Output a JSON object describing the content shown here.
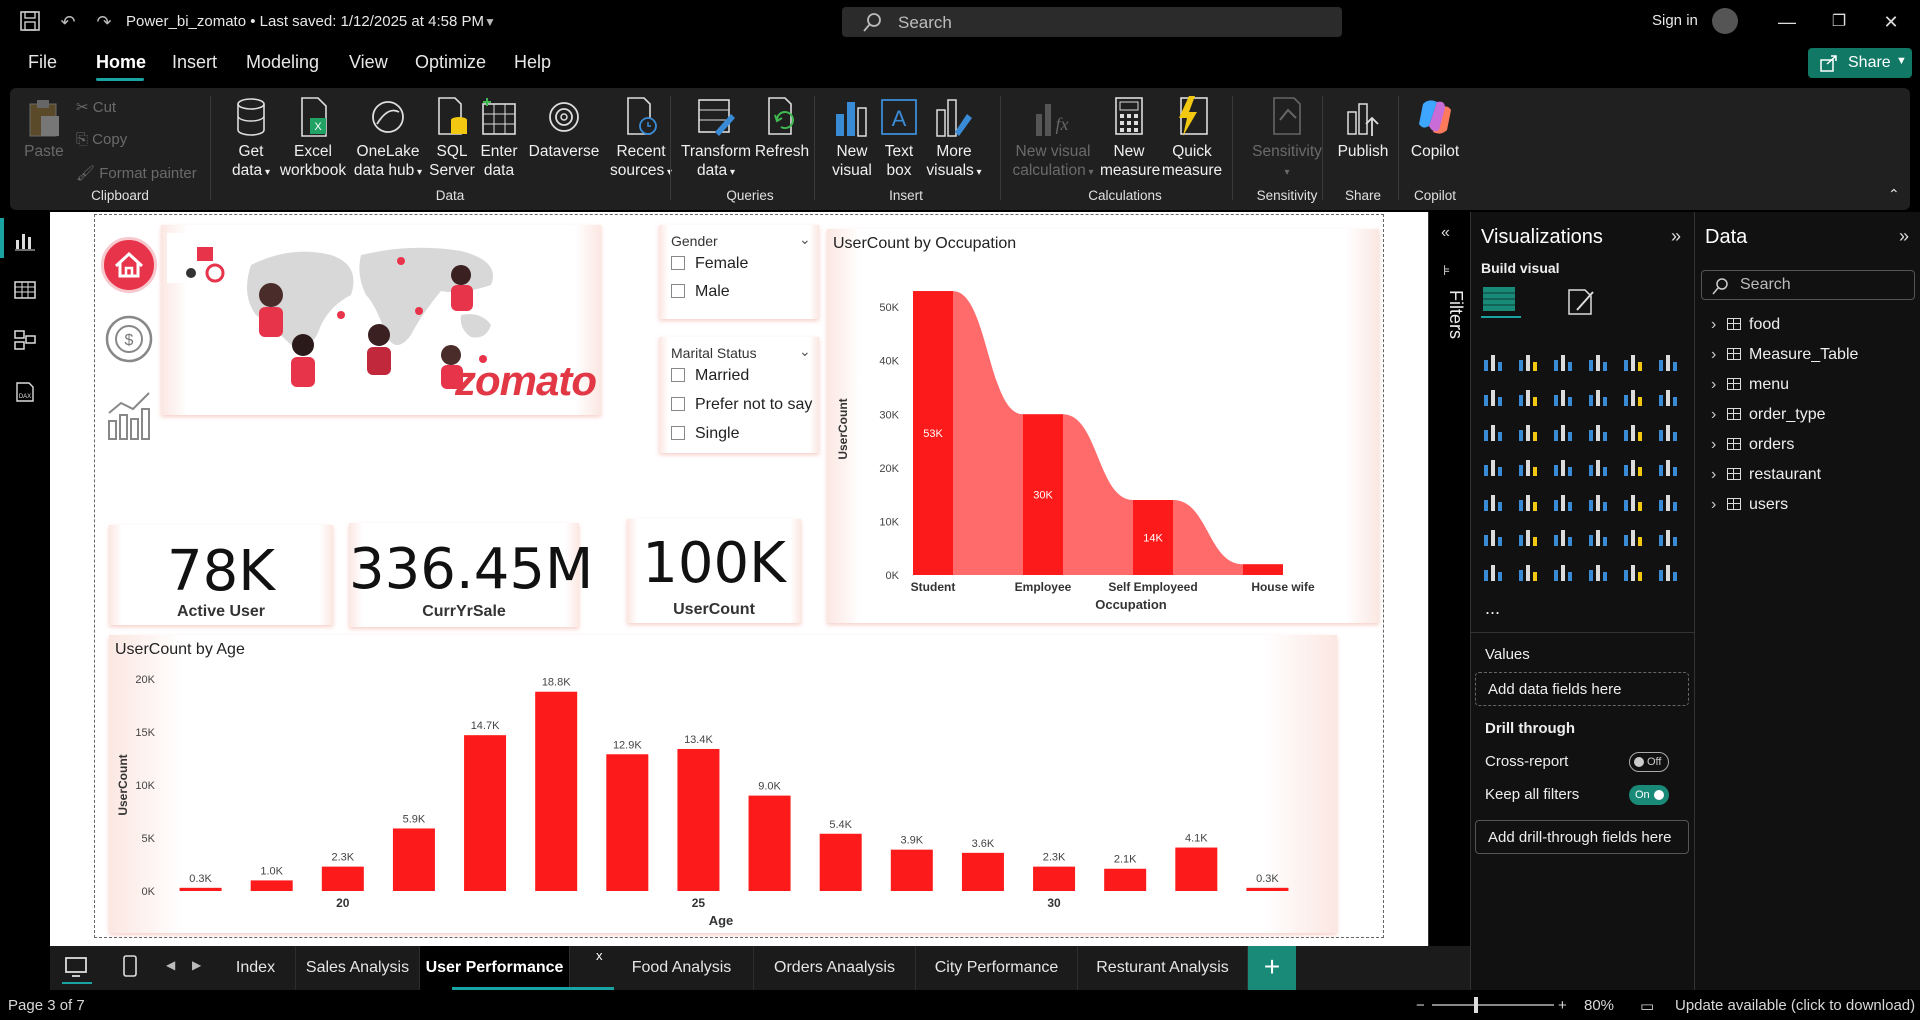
{
  "app": {
    "doc_title": "Power_bi_zomato • Last saved: 1/12/2025 at 4:58 PM",
    "search_placeholder": "Search",
    "sign_in": "Sign in"
  },
  "menu": {
    "items": [
      "File",
      "Home",
      "Insert",
      "Modeling",
      "View",
      "Optimize",
      "Help"
    ],
    "active": "Home",
    "share": "Share"
  },
  "ribbon": {
    "clipboard": {
      "paste": "Paste",
      "cut": "Cut",
      "copy": "Copy",
      "format_painter": "Format painter",
      "label": "Clipboard"
    },
    "data": {
      "get_data": [
        "Get",
        "data"
      ],
      "excel": [
        "Excel",
        "workbook"
      ],
      "onelake": [
        "OneLake",
        "data hub"
      ],
      "sql": [
        "SQL",
        "Server"
      ],
      "enter": [
        "Enter",
        "data"
      ],
      "dataverse": [
        "Dataverse",
        ""
      ],
      "recent": [
        "Recent",
        "sources"
      ],
      "label": "Data"
    },
    "queries": {
      "transform": [
        "Transform",
        "data"
      ],
      "refresh": [
        "Refresh",
        ""
      ],
      "label": "Queries"
    },
    "insert": {
      "new_visual": [
        "New",
        "visual"
      ],
      "text_box": [
        "Text",
        "box"
      ],
      "more_visuals": [
        "More",
        "visuals"
      ],
      "label": "Insert"
    },
    "calculations": {
      "new_visual_calc": [
        "New visual",
        "calculation"
      ],
      "new_measure": [
        "New",
        "measure"
      ],
      "quick_measure": [
        "Quick",
        "measure"
      ],
      "label": "Calculations"
    },
    "sensitivity": {
      "btn": [
        "Sensitivity",
        ""
      ],
      "label": "Sensitivity"
    },
    "share": {
      "publish": [
        "Publish",
        ""
      ],
      "label": "Share"
    },
    "copilot": {
      "btn": [
        "Copilot",
        ""
      ],
      "label": "Copilot"
    }
  },
  "report": {
    "brand": "zomato",
    "kpis": [
      {
        "value": "78K",
        "label": "Active User"
      },
      {
        "value": "336.45M",
        "label": "CurrYrSale"
      },
      {
        "value": "100K",
        "label": "UserCount"
      }
    ],
    "slicers": {
      "gender": {
        "title": "Gender",
        "options": [
          "Female",
          "Male"
        ]
      },
      "marital": {
        "title": "Marital Status",
        "options": [
          "Married",
          "Prefer not to say",
          "Single"
        ]
      }
    }
  },
  "chart_data": [
    {
      "type": "bar",
      "title": "UserCount by Occupation",
      "xlabel": "Occupation",
      "ylabel": "UserCount",
      "categories": [
        "Student",
        "Employee",
        "Self Employeed",
        "House wife"
      ],
      "values": [
        53000,
        30000,
        14000,
        2000
      ],
      "data_labels": [
        "53K",
        "30K",
        "14K",
        ""
      ],
      "y_ticks": [
        "0K",
        "10K",
        "20K",
        "30K",
        "40K",
        "50K"
      ],
      "ylim": [
        0,
        56000
      ],
      "grid": false,
      "color": "#fd1a1a",
      "ribbon_color": "#ff6b6b"
    },
    {
      "type": "bar",
      "title": "UserCount by Age",
      "xlabel": "Age",
      "ylabel": "UserCount",
      "categories": [
        18,
        19,
        20,
        21,
        22,
        23,
        24,
        25,
        26,
        27,
        28,
        29,
        30,
        31,
        32,
        33
      ],
      "values": [
        300,
        1000,
        2300,
        5900,
        14700,
        18800,
        12900,
        13400,
        9000,
        5400,
        3900,
        3600,
        2300,
        2100,
        4100,
        300
      ],
      "data_labels": [
        "0.3K",
        "1.0K",
        "2.3K",
        "5.9K",
        "14.7K",
        "18.8K",
        "12.9K",
        "13.4K",
        "9.0K",
        "5.4K",
        "3.9K",
        "3.6K",
        "2.3K",
        "2.1K",
        "4.1K",
        "0.3K"
      ],
      "x_tick_labels": {
        "20": "20",
        "25": "25",
        "30": "30"
      },
      "y_ticks": [
        "0K",
        "5K",
        "10K",
        "15K",
        "20K"
      ],
      "ylim": [
        0,
        20000
      ],
      "grid": false,
      "color": "#fd1a1a"
    }
  ],
  "visualizations": {
    "title": "Visualizations",
    "build_visual": "Build visual",
    "values_label": "Values",
    "add_data": "Add data fields here",
    "drill_through": "Drill through",
    "cross_report": "Cross-report",
    "cross_report_state": "Off",
    "keep_filters": "Keep all filters",
    "keep_filters_state": "On",
    "add_drill": "Add drill-through fields here",
    "more": "..."
  },
  "data_pane": {
    "title": "Data",
    "search_placeholder": "Search",
    "tables": [
      "food",
      "Measure_Table",
      "menu",
      "order_type",
      "orders",
      "restaurant",
      "users"
    ]
  },
  "filters_label": "Filters",
  "pages": {
    "tabs": [
      "Index",
      "Sales Analysis",
      "User Performance",
      "Food Analysis",
      "Orders Anaalysis",
      "City Performance",
      "Resturant Analysis"
    ],
    "active": "User Performance",
    "close": "x"
  },
  "status": {
    "page": "Page 3 of 7",
    "zoom": "80%",
    "update": "Update available (click to download)"
  }
}
